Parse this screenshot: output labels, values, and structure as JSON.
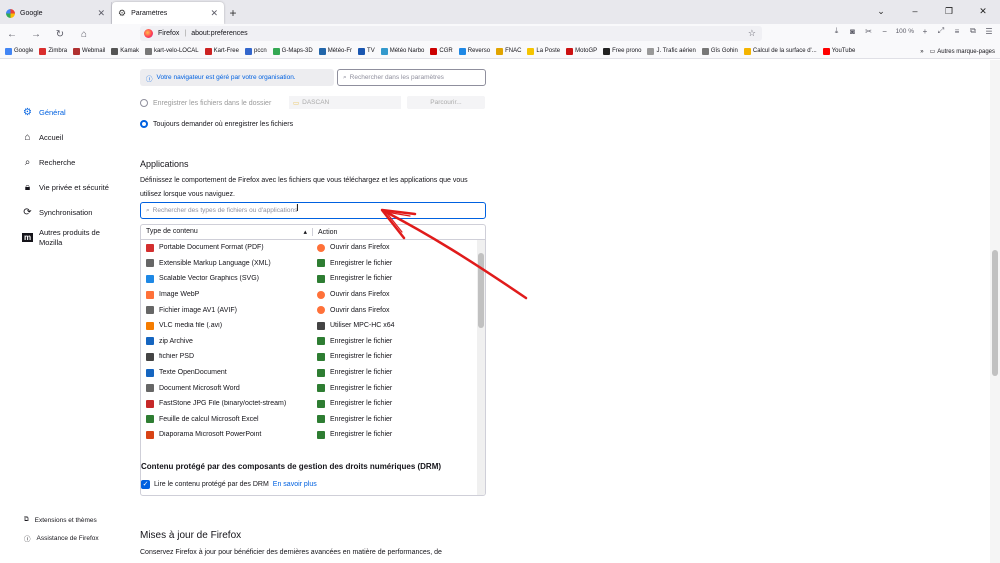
{
  "tabs": [
    {
      "label": "Google",
      "active": false
    },
    {
      "label": "Paramètres",
      "active": true
    }
  ],
  "window_controls": [
    "–",
    "❐",
    "✕"
  ],
  "urlbar": {
    "identity": "Firefox",
    "url": "about:preferences"
  },
  "nav_right": {
    "zoom": "100 %"
  },
  "bookmarks": [
    {
      "label": "Google",
      "color": "#4285f4"
    },
    {
      "label": "Zimbra",
      "color": "#d92d2d"
    },
    {
      "label": "Webmail",
      "color": "#b03030"
    },
    {
      "label": "Kamak",
      "color": "#555555"
    },
    {
      "label": "kart-velo-LOCAL",
      "color": "#777777"
    },
    {
      "label": "Kart-Free",
      "color": "#cc2222"
    },
    {
      "label": "pccn",
      "color": "#3366cc"
    },
    {
      "label": "G-Maps-3D",
      "color": "#34a853"
    },
    {
      "label": "Météo-Fr",
      "color": "#2266aa"
    },
    {
      "label": "TV",
      "color": "#1a56b0"
    },
    {
      "label": "Météo Narbo",
      "color": "#3399cc"
    },
    {
      "label": "CGR",
      "color": "#cc0000"
    },
    {
      "label": "Reverso",
      "color": "#1e88e5"
    },
    {
      "label": "FNAC",
      "color": "#e1a400"
    },
    {
      "label": "La Poste",
      "color": "#f5c400"
    },
    {
      "label": "MotoGP",
      "color": "#cc1111"
    },
    {
      "label": "Free prono",
      "color": "#222222"
    },
    {
      "label": "J. Trafic aérien",
      "color": "#999999"
    },
    {
      "label": "Gîs Gohin",
      "color": "#777777"
    },
    {
      "label": "Calcul de la surface d'...",
      "color": "#f4b400"
    },
    {
      "label": "YouTube",
      "color": "#ff0000"
    }
  ],
  "bookmarks_other": "Autres marque-pages",
  "sidebar": {
    "items": [
      {
        "label": "Général",
        "icon": "gear-icon",
        "glyph": "⚙",
        "selected": true
      },
      {
        "label": "Accueil",
        "icon": "home-icon",
        "glyph": "⌂",
        "selected": false
      },
      {
        "label": "Recherche",
        "icon": "search-icon",
        "glyph": "⌕",
        "selected": false
      },
      {
        "label": "Vie privée et sécurité",
        "icon": "lock-icon",
        "glyph": "🔒︎",
        "selected": false
      },
      {
        "label": "Synchronisation",
        "icon": "sync-icon",
        "glyph": "⟳",
        "selected": false
      },
      {
        "label": "Autres produits de Mozilla",
        "icon": "mozilla-icon",
        "glyph": "m",
        "selected": false
      }
    ],
    "bottom": [
      {
        "label": "Extensions et thèmes",
        "icon": "puzzle-icon",
        "glyph": "⧉"
      },
      {
        "label": "Assistance de Firefox",
        "icon": "help-icon",
        "glyph": "ⓘ"
      }
    ]
  },
  "policy_notice": "Votre navigateur est géré par votre organisation.",
  "settings_search_placeholder": "Rechercher dans les paramètres",
  "downloads": {
    "save_to_label": "Enregistrer les fichiers dans le dossier",
    "folder": "DASCAN",
    "browse_label": "Parcourir...",
    "always_ask_label": "Toujours demander où enregistrer les fichiers"
  },
  "applications": {
    "heading": "Applications",
    "description": "Définissez le comportement de Firefox avec les fichiers que vous téléchargez et les applications que vous utilisez lorsque vous naviguez.",
    "search_placeholder": "Rechercher des types de fichiers ou d'applications",
    "col_type": "Type de contenu",
    "col_action": "Action",
    "rows": [
      {
        "type": "Portable Document Format (PDF)",
        "type_color": "#d32f2f",
        "action": "Ouvrir dans Firefox",
        "action_color": "#ff7139"
      },
      {
        "type": "Extensible Markup Language (XML)",
        "type_color": "#666666",
        "action": "Enregistrer le fichier",
        "action_color": "#2e7d32"
      },
      {
        "type": "Scalable Vector Graphics (SVG)",
        "type_color": "#1e88e5",
        "action": "Enregistrer le fichier",
        "action_color": "#2e7d32"
      },
      {
        "type": "Image WebP",
        "type_color": "#ff7139",
        "action": "Ouvrir dans Firefox",
        "action_color": "#ff7139"
      },
      {
        "type": "Fichier image AV1 (AVIF)",
        "type_color": "#666666",
        "action": "Ouvrir dans Firefox",
        "action_color": "#ff7139"
      },
      {
        "type": "VLC media file (.avi)",
        "type_color": "#f57c00",
        "action": "Utiliser MPC-HC x64",
        "action_color": "#444444"
      },
      {
        "type": "zip Archive",
        "type_color": "#1565c0",
        "action": "Enregistrer le fichier",
        "action_color": "#2e7d32"
      },
      {
        "type": "fichier PSD",
        "type_color": "#444444",
        "action": "Enregistrer le fichier",
        "action_color": "#2e7d32"
      },
      {
        "type": "Texte OpenDocument",
        "type_color": "#1565c0",
        "action": "Enregistrer le fichier",
        "action_color": "#2e7d32"
      },
      {
        "type": "Document Microsoft Word",
        "type_color": "#666666",
        "action": "Enregistrer le fichier",
        "action_color": "#2e7d32"
      },
      {
        "type": "FastStone JPG File (binary/octet-stream)",
        "type_color": "#c62828",
        "action": "Enregistrer le fichier",
        "action_color": "#2e7d32"
      },
      {
        "type": "Feuille de calcul Microsoft Excel",
        "type_color": "#2e7d32",
        "action": "Enregistrer le fichier",
        "action_color": "#2e7d32"
      },
      {
        "type": "Diaporama Microsoft PowerPoint",
        "type_color": "#d84315",
        "action": "Enregistrer le fichier",
        "action_color": "#2e7d32"
      }
    ]
  },
  "drm": {
    "heading": "Contenu protégé par des composants de gestion des droits numériques (DRM)",
    "checkbox_label": "Lire le contenu protégé par des DRM",
    "learn_more": "En savoir plus"
  },
  "updates": {
    "heading": "Mises à jour de Firefox",
    "description": "Conservez Firefox à jour pour bénéficier des dernières avancées en matière de performances, de"
  },
  "colors": {
    "accent": "#0061e0",
    "annotation_arrow": "#e01b1b"
  }
}
